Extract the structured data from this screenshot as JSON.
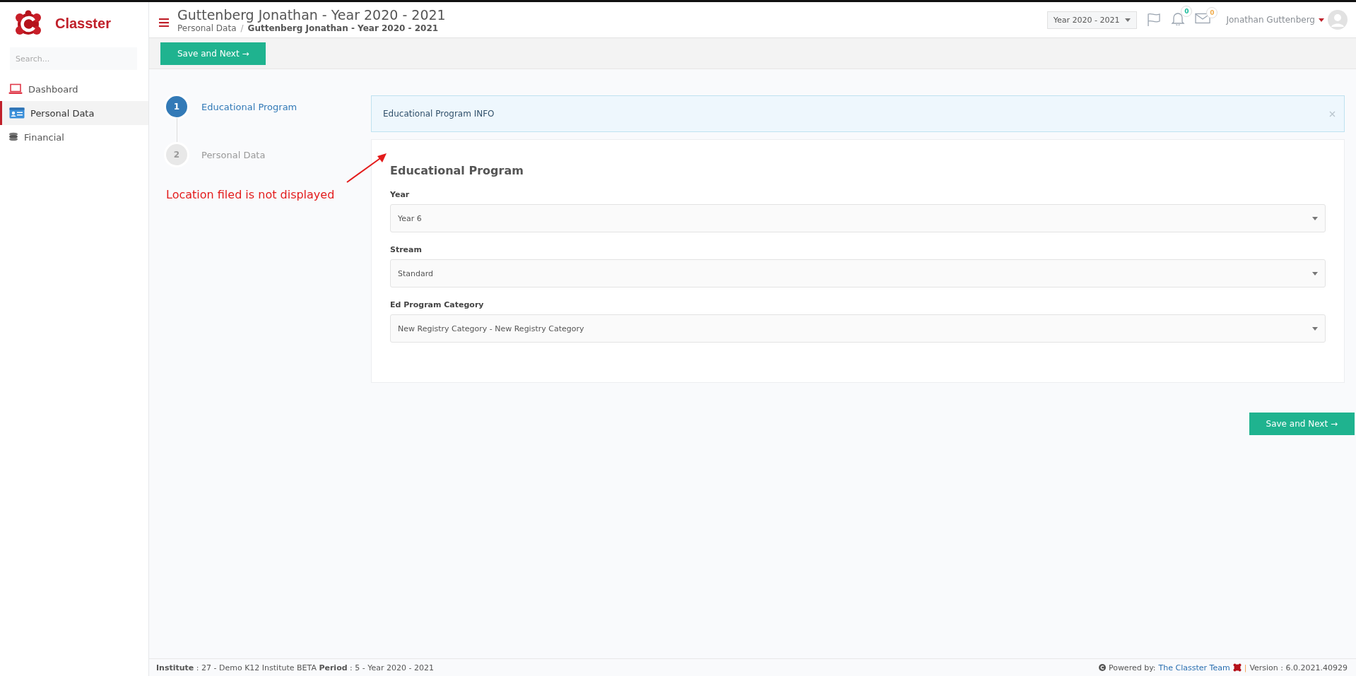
{
  "sidebar": {
    "brand": "Classter",
    "search": {
      "placeholder": "Search..."
    },
    "items": [
      {
        "label": "Dashboard",
        "selected": false
      },
      {
        "label": "Personal Data",
        "selected": true
      },
      {
        "label": "Financial",
        "selected": false
      }
    ]
  },
  "header": {
    "title": "Guttenberg Jonathan - Year 2020 - 2021",
    "breadcrumb_separator": "/",
    "breadcrumb": [
      {
        "label": "Personal Data",
        "current": false
      },
      {
        "label": "Guttenberg Jonathan - Year 2020 - 2021",
        "current": true
      }
    ],
    "year_select": "Year 2020 - 2021",
    "notifications": [
      {
        "count": "0",
        "color": "#1abc9c"
      },
      {
        "count": "0",
        "color": "#f0ad4e"
      }
    ],
    "user": "Jonathan Guttenberg"
  },
  "toolbar": {
    "button": "Save and Next →"
  },
  "steps": [
    {
      "number": "1",
      "label": "Educational Program",
      "selected": true
    },
    {
      "number": "2",
      "label": "Personal Data",
      "selected": false
    }
  ],
  "annotation": {
    "text": "Location filed is not displayed"
  },
  "info": {
    "text": "Educational Program INFO"
  },
  "form": {
    "title": "Educational Program",
    "fields": [
      {
        "label": "Year",
        "value": "Year 6"
      },
      {
        "label": "Stream",
        "value": "Standard"
      },
      {
        "label": "Ed Program Category",
        "value": "New Registry Category - New Registry Category"
      }
    ]
  },
  "bottom_button": "Save and Next →",
  "footer": {
    "left": "**Institute** : 27 - Demo K12 Institute BETA **Period** : 5 - Year 2020 - 2021",
    "powered": "Powered by:",
    "link": "The Classter Team",
    "separator": "|",
    "version": "Version : 6.0.2021.40929"
  }
}
